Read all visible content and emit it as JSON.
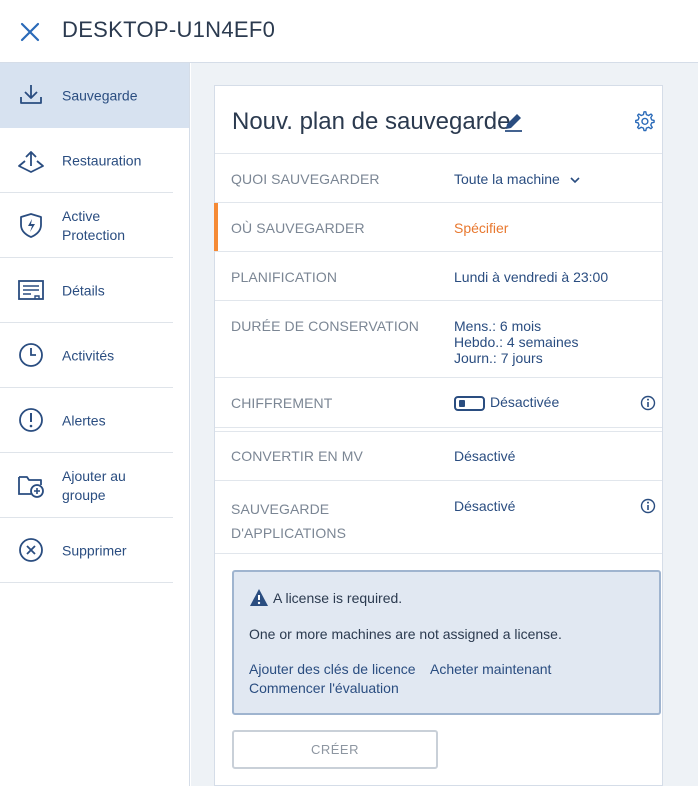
{
  "header": {
    "title": "DESKTOP-U1N4EF0"
  },
  "sidebar": {
    "items": [
      {
        "label": "Sauvegarde",
        "icon": "backup-icon"
      },
      {
        "label": "Restauration",
        "icon": "recovery-icon"
      },
      {
        "label": "Active Protection",
        "icon": "shield-icon"
      },
      {
        "label": "Détails",
        "icon": "details-icon"
      },
      {
        "label": "Activités",
        "icon": "clock-icon"
      },
      {
        "label": "Alertes",
        "icon": "alert-icon"
      },
      {
        "label": "Ajouter au groupe",
        "icon": "add-folder-icon"
      },
      {
        "label": "Supprimer",
        "icon": "delete-circle-icon"
      }
    ]
  },
  "plan": {
    "title": "Nouv. plan de sauvegarde",
    "rows": {
      "what": {
        "label": "QUOI SAUVEGARDER",
        "value": "Toute la machine"
      },
      "where": {
        "label": "OÙ SAUVEGARDER",
        "value": "Spécifier"
      },
      "schedule": {
        "label": "PLANIFICATION",
        "value": "Lundi à vendredi à 23:00"
      },
      "retention": {
        "label": "DURÉE DE CONSERVATION",
        "values": [
          "Mens.: 6 mois",
          "Hebdo.: 4 semaines",
          "Journ.: 7 jours"
        ]
      },
      "encryption": {
        "label": "CHIFFREMENT",
        "value": "Désactivée"
      },
      "convert": {
        "label": "CONVERTIR EN MV",
        "value": "Désactivé"
      },
      "apps": {
        "label": "SAUVEGARDE D'APPLICATIONS",
        "value": "Désactivé"
      }
    }
  },
  "license": {
    "title": "A license is required.",
    "message": "One or more machines are not assigned a license.",
    "links": {
      "add_keys": "Ajouter des clés de licence",
      "buy": "Acheter maintenant",
      "trial": "Commencer l'évaluation"
    }
  },
  "actions": {
    "create_label": "CRÉER"
  },
  "colors": {
    "accent": "#2a4d80",
    "warning": "#f58a35",
    "sidebar_active": "#d7e2f0",
    "background": "#eef2f6"
  }
}
